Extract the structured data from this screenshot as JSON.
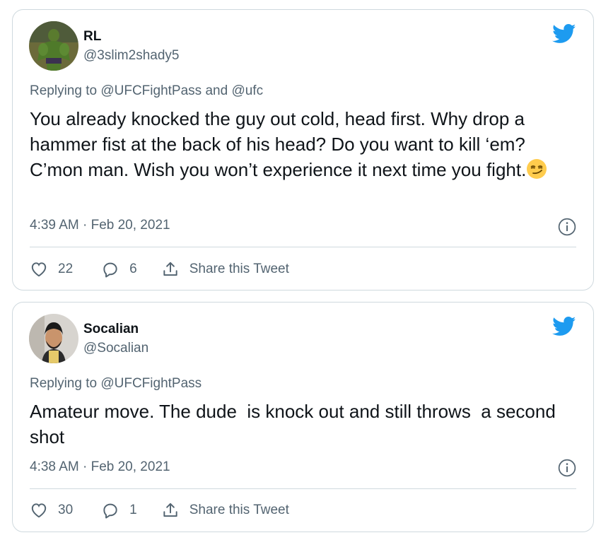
{
  "colors": {
    "text": "#0f1419",
    "secondary": "#536471",
    "border": "#cfd9de",
    "twitter_blue": "#1d9bf0"
  },
  "tweets": [
    {
      "name": "RL",
      "handle": "@3slim2shady5",
      "replying_prefix": "Replying to",
      "replying_to": [
        "@UFCFightPass",
        "@ufc"
      ],
      "replying_join": "and",
      "text": "You already knocked the guy out cold, head first. Why drop a hammer fist at the back of his head? Do you want to kill ‘em? C’mon man. Wish you won’t experience it next time you fight.",
      "emoji": "smirking-face-emoji",
      "timestamp": "4:39 AM · Feb 20, 2021",
      "likes": "22",
      "replies": "6",
      "share_label": "Share this Tweet"
    },
    {
      "name": "Socalian",
      "handle": "@Socalian",
      "replying_prefix": "Replying to",
      "replying_to": [
        "@UFCFightPass"
      ],
      "text": "Amateur move. The dude  is knock out and still throws  a second shot",
      "timestamp": "4:38 AM · Feb 20, 2021",
      "likes": "30",
      "replies": "1",
      "share_label": "Share this Tweet"
    }
  ]
}
